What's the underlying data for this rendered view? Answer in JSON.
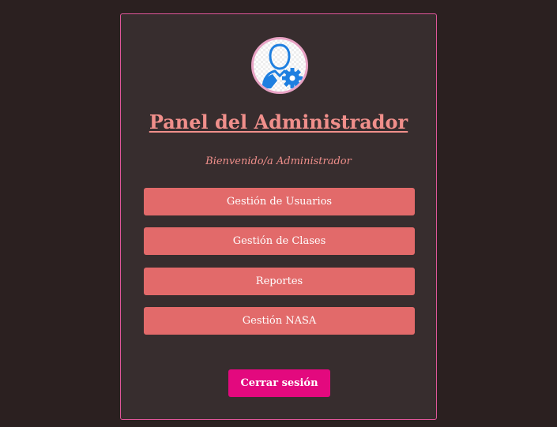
{
  "panel": {
    "title": "Panel del Administrador",
    "welcome": "Bienvenido/a Administrador",
    "avatar_icon": "admin-user-gear-icon"
  },
  "menu": {
    "items": [
      {
        "label": "Gestión de Usuarios"
      },
      {
        "label": "Gestión de Clases"
      },
      {
        "label": "Reportes"
      },
      {
        "label": "Gestión NASA"
      }
    ]
  },
  "logout": {
    "label": "Cerrar sesión"
  },
  "colors": {
    "page_background": "#2b2020",
    "panel_background": "#372d2e",
    "panel_border": "#e0569a",
    "title_color": "#f08f8b",
    "menu_button": "#e26a6a",
    "logout_button": "#e3097e",
    "icon_blue": "#1e7fe0"
  }
}
